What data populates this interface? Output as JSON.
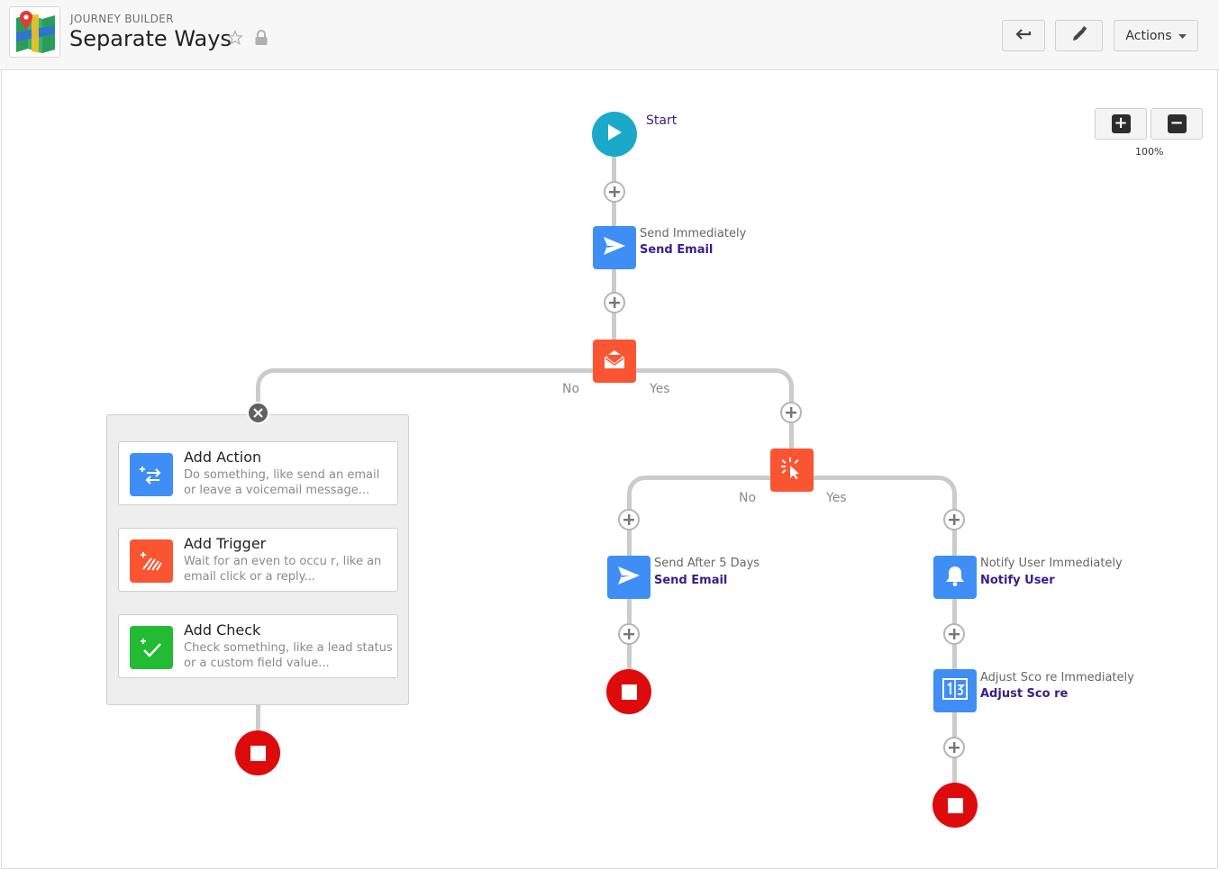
{
  "header": {
    "eyebrow": "JOURNEY BUILDER",
    "title": "Separate Ways",
    "actions_label": "Actions"
  },
  "zoom": {
    "level": "100%"
  },
  "flow": {
    "start_label": "Start",
    "step1": {
      "timing": "Send Immediately",
      "action": "Send Email"
    },
    "decision1": {
      "no": "No",
      "yes": "Yes"
    },
    "decision2": {
      "no": "No",
      "yes": "Yes"
    },
    "step_no": {
      "timing": "Send After 5 Days",
      "action": "Send Email"
    },
    "step_yes1": {
      "timing": "Notify User Immediately",
      "action": "Notify User"
    },
    "step_yes2": {
      "timing": "Adjust Sco re Immediately",
      "action": "Adjust Sco re"
    }
  },
  "add_panel": {
    "cards": [
      {
        "title": "Add Action",
        "desc": "Do something, like send an email or leave a voicemail message...",
        "color": "#3f8ef5"
      },
      {
        "title": "Add Trigger",
        "desc": "Wait for an even to occu   r, like an email click or a    reply...",
        "color": "#fa5532"
      },
      {
        "title": "Add Check",
        "desc": "Check something, like a lead status or a custom field value...",
        "color": "#22bb33"
      }
    ]
  },
  "colors": {
    "start": "#1ba9c9",
    "stop": "#dd0b0b",
    "action": "#3f8ef5",
    "trigger": "#fa5532",
    "check": "#22bb33",
    "label_link": "#3a1d8a"
  },
  "icons": [
    "map-logo-icon",
    "star-icon",
    "lock-icon",
    "back-arrow-icon",
    "pencil-icon",
    "caret-down-icon",
    "zoom-in-icon",
    "zoom-out-icon",
    "play-icon",
    "send-icon",
    "email-open-icon",
    "click-icon",
    "bell-icon",
    "score-icon",
    "stop-icon",
    "close-icon",
    "plus-icon"
  ]
}
